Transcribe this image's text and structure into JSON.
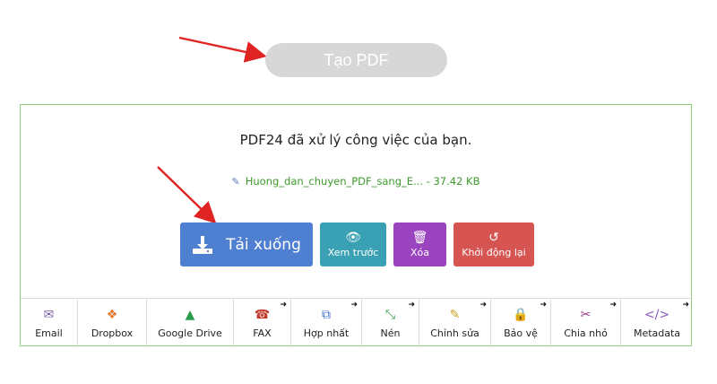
{
  "create_button": {
    "label": "Tạo PDF"
  },
  "panel": {
    "message": "PDF24 đã xử lý công việc của bạn.",
    "file": {
      "name": "Huong_dan_chuyen_PDF_sang_E...",
      "size": "- 37.42 KB"
    }
  },
  "actions": {
    "download": "Tải xuống",
    "preview": "Xem trước",
    "delete": "Xóa",
    "restart": "Khởi động lại"
  },
  "tools": [
    {
      "label": "Email",
      "icon": "✉",
      "icon_name": "email-icon",
      "color": "#7b5ea7",
      "ext": false
    },
    {
      "label": "Dropbox",
      "icon": "❖",
      "icon_name": "dropbox-icon",
      "color": "#e07a2f",
      "ext": false
    },
    {
      "label": "Google Drive",
      "icon": "▲",
      "icon_name": "google-drive-icon",
      "color": "#2a9d4a",
      "ext": false
    },
    {
      "label": "FAX",
      "icon": "☎",
      "icon_name": "fax-icon",
      "color": "#c0392b",
      "ext": true
    },
    {
      "label": "Hợp nhất",
      "icon": "⧉",
      "icon_name": "merge-icon",
      "color": "#3a6fd0",
      "ext": true
    },
    {
      "label": "Nén",
      "icon": "⤡",
      "icon_name": "compress-icon",
      "color": "#3a9a4a",
      "ext": true
    },
    {
      "label": "Chỉnh sửa",
      "icon": "✎",
      "icon_name": "edit-icon",
      "color": "#c9a227",
      "ext": true
    },
    {
      "label": "Bảo vệ",
      "icon": "🔒",
      "icon_name": "lock-icon",
      "color": "#5a6fb0",
      "ext": true
    },
    {
      "label": "Chia nhỏ",
      "icon": "✂",
      "icon_name": "scissors-icon",
      "color": "#9a3a8a",
      "ext": true
    },
    {
      "label": "Metadata",
      "icon": "</>",
      "icon_name": "code-icon",
      "color": "#8a5ac0",
      "ext": true
    }
  ],
  "ext_icon": "➜",
  "colors": {
    "annotation_arrow": "#e02424",
    "panel_border": "#8fd07f"
  }
}
